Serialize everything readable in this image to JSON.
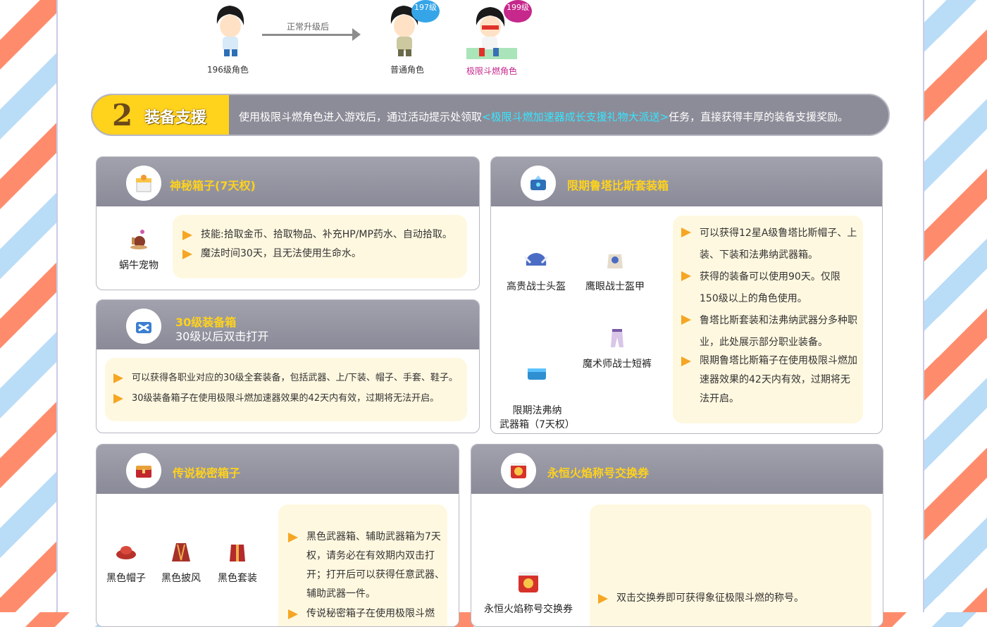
{
  "upgrade_flow": {
    "from_caption": "196级角色",
    "arrow_label": "正常升级后",
    "normal_caption": "普通角色",
    "normal_level": "197级",
    "extreme_caption": "极限斗燃角色",
    "extreme_level": "199级"
  },
  "section2": {
    "number": "2",
    "title": "装备支援",
    "desc_prefix": "使用极限斗燃角色进入游戏后，通过活动提示处领取",
    "desc_highlight": "<极限斗燃加速器成长支援礼物大派送>",
    "desc_suffix": "任务，直接获得丰厚的装备支援奖励。"
  },
  "box_mystery": {
    "title": "神秘箱子(7天权)",
    "item": "蜗牛宠物",
    "bullets": [
      "技能:拾取金币、拾取物品、补充HP/MP药水、自动拾取。",
      "魔法时间30天，且无法使用生命水。"
    ]
  },
  "box_lv30": {
    "title": "30级装备箱",
    "subtitle": "30级以后双击打开",
    "bullets": [
      "可以获得各职业对应的30级全套装备，包括武器、上/下装、帽子、手套、鞋子。",
      "30级装备箱子在使用极限斗燃加速器效果的42天内有效，过期将无法开启。"
    ]
  },
  "box_rutabyss": {
    "title": "限期鲁塔比斯套装箱",
    "items": [
      "高贵战士头盔",
      "鹰眼战士盔甲",
      "限期法弗纳\n武器箱（7天权）",
      "魔术师战士短裤"
    ],
    "bullets": [
      "可以获得12星A级鲁塔比斯帽子、上装、下装和法弗纳武器箱。",
      "获得的装备可以使用90天。仅限150级以上的角色使用。",
      "鲁塔比斯套装和法弗纳武器分多种职业，此处展示部分职业装备。",
      "限期鲁塔比斯箱子在使用极限斗燃加速器效果的42天内有效，过期将无法开启。"
    ]
  },
  "box_legend": {
    "title": "传说秘密箱子",
    "items": [
      "黑色帽子",
      "黑色披风",
      "黑色套装"
    ],
    "bullets": [
      "黑色武器箱、辅助武器箱为7天权，请务必在有效期内双击打开；打开后可以获得任意武器、辅助武器一件。",
      "传说秘密箱子在使用极限斗燃"
    ]
  },
  "box_flame": {
    "title": "永恒火焰称号交换券",
    "item": "永恒火焰称号交换券",
    "bullets": [
      "双击交换券即可获得象征极限斗燃的称号。"
    ]
  },
  "colors": {
    "accent_yellow": "#ffd21c",
    "header_gray": "#8a8a98",
    "highlight_cyan": "#35e6ff",
    "note_bg": "#fff8e0",
    "bullet_orange": "#f5a623"
  },
  "icons": {
    "mystery": "gift-box-icon",
    "lv30": "equipment-box-icon",
    "rutabyss": "gem-box-icon",
    "legend": "treasure-chest-icon",
    "flame": "flame-ticket-icon"
  }
}
